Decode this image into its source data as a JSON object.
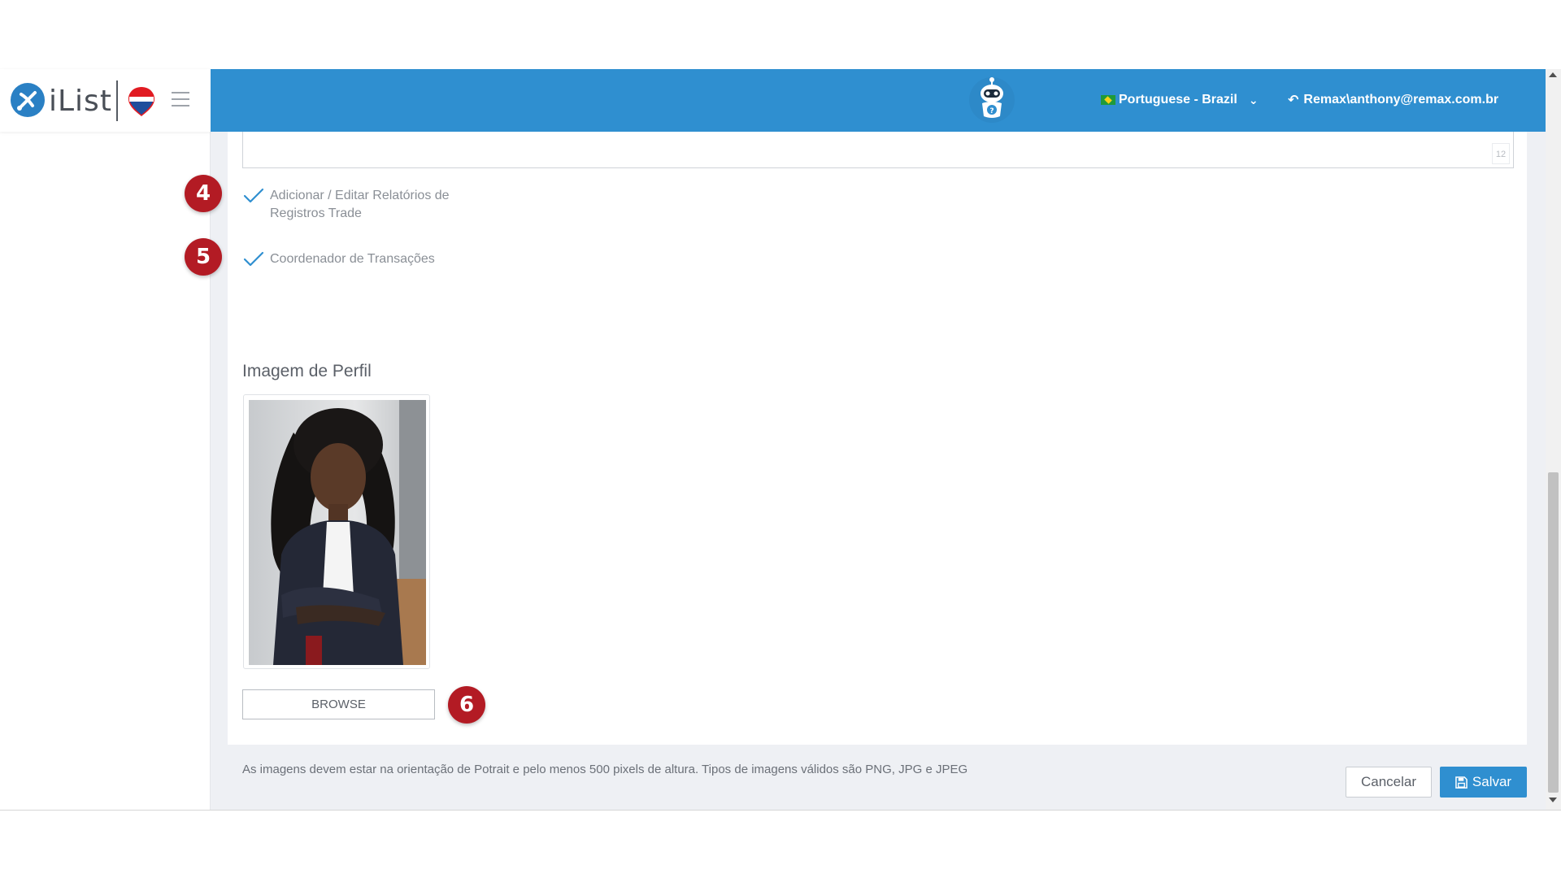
{
  "brand": {
    "app_name": "iList",
    "partner_logo_icon": "remax-balloon-icon",
    "menu_icon": "hamburger-menu-icon"
  },
  "topbar": {
    "assistant_icon": "robot-assistant-icon",
    "language": {
      "flag_icon": "brazil-flag-icon",
      "label": "Portuguese - Brazil",
      "chevron": "chevron-down-icon"
    },
    "user": {
      "icon": "reply-arrow-icon",
      "label": "Remax\\anthony@remax.com.br"
    }
  },
  "form": {
    "textarea_counter": "12",
    "steps": [
      {
        "number": "4",
        "label": "Adicionar / Editar Relatórios de Registros Trade",
        "checked": true
      },
      {
        "number": "5",
        "label": "Coordenador de Transações",
        "checked": true
      }
    ],
    "profile_image": {
      "title": "Imagem de Perfil",
      "browse_label": "BROWSE",
      "browse_step": "6",
      "hint": "As imagens devem estar na orientação de Potrait e pelo menos 500 pixels de altura. Tipos de imagens válidos são PNG, JPG e JPEG"
    }
  },
  "actions": {
    "cancel_label": "Cancelar",
    "save_label": "Salvar",
    "save_icon": "floppy-disk-icon"
  },
  "colors": {
    "primary": "#2f8fd0",
    "badge": "#b31b24",
    "check": "#2f8fd0",
    "page_bg": "#eef0f4"
  }
}
